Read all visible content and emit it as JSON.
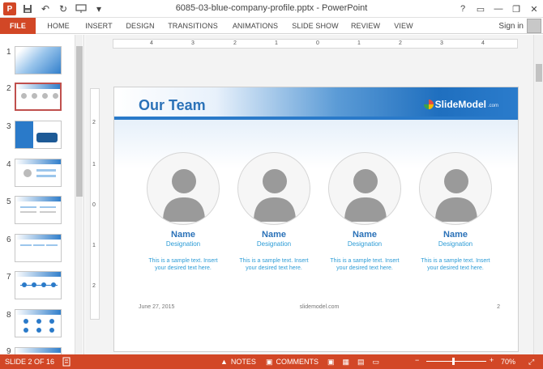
{
  "window": {
    "title": "6085-03-blue-company-profile.pptx - PowerPoint",
    "controls": [
      "?",
      "▭",
      "—",
      "❐",
      "✕"
    ]
  },
  "quick_access": {
    "app_icon": "powerpoint-icon",
    "items": [
      "save-icon",
      "undo-icon",
      "redo-icon",
      "present-icon",
      "customize-icon"
    ]
  },
  "ribbon": {
    "file_label": "FILE",
    "tabs": [
      "HOME",
      "INSERT",
      "DESIGN",
      "TRANSITIONS",
      "ANIMATIONS",
      "SLIDE SHOW",
      "REVIEW",
      "VIEW"
    ],
    "sign_in": "Sign in"
  },
  "thumbnails": {
    "numbers": [
      "1",
      "2",
      "3",
      "4",
      "5",
      "6",
      "7",
      "8",
      "9"
    ],
    "selected": "2"
  },
  "ruler": {
    "h_labels": [
      "4",
      "3",
      "2",
      "1",
      "0",
      "1",
      "2",
      "3",
      "4"
    ],
    "v_labels": [
      "2",
      "1",
      "0",
      "1",
      "2"
    ]
  },
  "slide": {
    "title": "Our Team",
    "logo_text": "SlideModel",
    "logo_sub": ".com",
    "members": [
      {
        "name": "Name",
        "designation": "Designation",
        "text": "This is a sample text. Insert your desired text here."
      },
      {
        "name": "Name",
        "designation": "Designation",
        "text": "This is a sample text. Insert your desired text here."
      },
      {
        "name": "Name",
        "designation": "Designation",
        "text": "This is a sample text. Insert your desired text here."
      },
      {
        "name": "Name",
        "designation": "Designation",
        "text": "This is a sample text. Insert your desired text here."
      }
    ],
    "footer": {
      "date": "June 27, 2015",
      "site": "slidemodel.com",
      "number": "2"
    }
  },
  "status": {
    "slide_info": "SLIDE 2 OF 16",
    "notes": "NOTES",
    "comments": "COMMENTS",
    "zoom_percent": "70%",
    "zoom_level": 0.45
  },
  "colors": {
    "accent": "#d24726",
    "title_blue": "#2b72b8",
    "text_blue": "#2b9bd6"
  }
}
